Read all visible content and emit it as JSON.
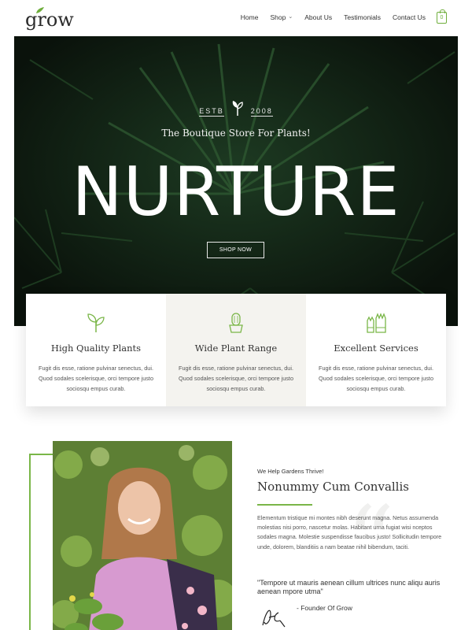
{
  "header": {
    "logo_text": "grow",
    "nav": [
      {
        "label": "Home"
      },
      {
        "label": "Shop",
        "has_dropdown": true
      },
      {
        "label": "About Us"
      },
      {
        "label": "Testimonials"
      },
      {
        "label": "Contact Us"
      }
    ],
    "cart_count": "0",
    "accent": "#6fae3c"
  },
  "hero": {
    "estb_left": "ESTB",
    "estb_right": "2008",
    "tagline": "The Boutique Store For Plants!",
    "title": "NURTURE",
    "button_label": "SHOP NOW"
  },
  "features": [
    {
      "icon": "plant-icon",
      "title": "High Quality Plants",
      "text": "Fugit dis esse, ratione pulvinar senectus, dui. Quod sodales scelerisque, orci tempore justo sociosqu empus curab."
    },
    {
      "icon": "cactus-icon",
      "title": "Wide Plant Range",
      "text": "Fugit dis esse, ratione pulvinar senectus, dui. Quod sodales scelerisque, orci tempore justo sociosqu empus curab."
    },
    {
      "icon": "gloves-icon",
      "title": "Excellent Services",
      "text": "Fugit dis esse, ratione pulvinar senectus, dui. Quod sodales scelerisque, orci tempore justo sociosqu empus curab."
    }
  ],
  "about": {
    "kicker": "We Help Gardens Thrive!",
    "title": "Nonummy Cum Convallis",
    "body": "Elementum tristique mi montes nibh deserunt magna. Netus assumenda molestias nisi porro, nascetur molas. Habitant urna fugiat wisi nceptos sodales magna. Molestie suspendisse faucibus justo! Sollicitudin tempore unde, dolorem, blanditiis a nam beatae nihil bibendum, taciti.",
    "quote": "\"Tempore ut mauris aenean cillum ultrices nunc aliqu auris aenean mpore utma\"",
    "founder": "- Founder Of Grow"
  }
}
